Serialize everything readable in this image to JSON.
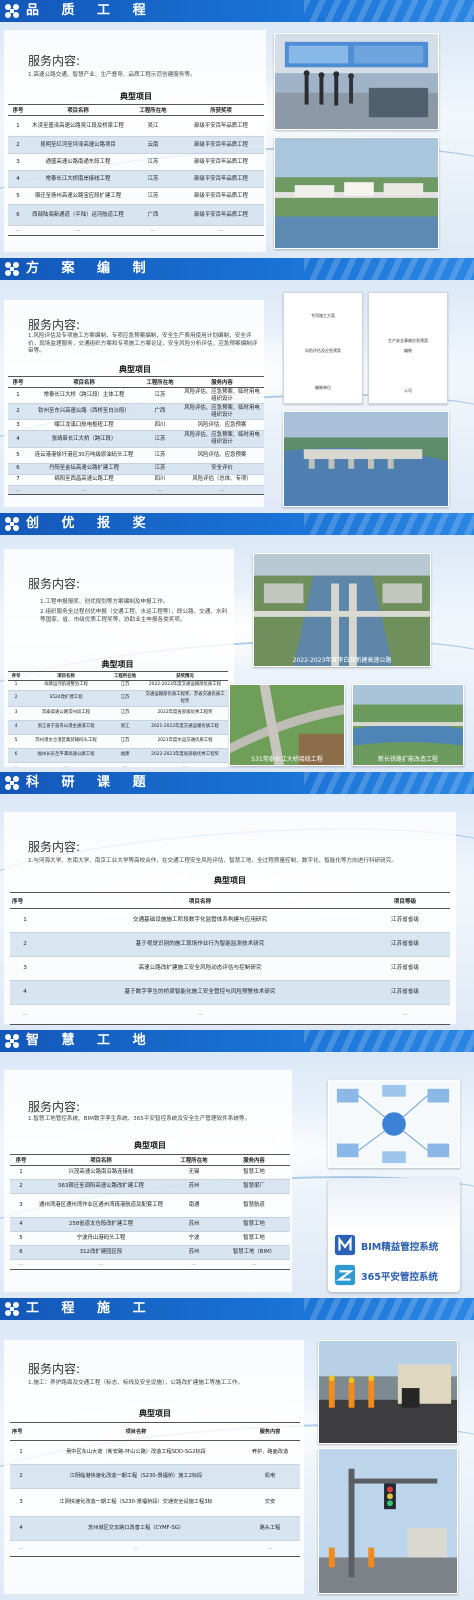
{
  "sections": {
    "s1": {
      "title": "品 质 工 程",
      "service_title": "服务内容:",
      "service_text": "1.高速公路交通、智慧产业、生产督导、品质工程示范创建服务等。",
      "table_title": "典型项目",
      "headers": [
        "序号",
        "项目名称",
        "工程所在地",
        "所获奖项"
      ],
      "rows": [
        [
          "1",
          "木渎至盛泽高速公路吴江段及桥梁工程",
          "吴江",
          "部级平安百年品质工程"
        ],
        [
          "2",
          "昆明至红河至坪泽高速公路项目",
          "云南",
          "部级平安百年品质工程"
        ],
        [
          "3",
          "通盛高速公路南通东段工程",
          "江苏",
          "部级平安百年品质工程"
        ],
        [
          "4",
          "常泰长江大桥南岸接线工程",
          "江苏",
          "部级平安百年品质工程"
        ],
        [
          "5",
          "宿迁至扬州高速公路宝应段扩建工程",
          "江苏",
          "部级平安百年品质工程"
        ],
        [
          "6",
          "西部陆海新通道（平陆）运河航道工程",
          "广西",
          "部级平安百年品质工程"
        ],
        [
          "…",
          "…",
          "…",
          "…"
        ]
      ]
    },
    "s2": {
      "title": "方 案 编 制",
      "service_title": "服务内容:",
      "service_text": "1.风险评估及专项施工方案编制，专项应急预案编制，安全生产费用使用计划编制，安全评价，现场监理服务，交通组织方案和专项施工方案论证，安全风险分析评估，应急预案编制评审等。",
      "table_title": "典型项目",
      "headers": [
        "序号",
        "项目名称",
        "工程所在地",
        "服务内容"
      ],
      "rows": [
        [
          "1",
          "常泰长江大桥（跨江段）主体工程",
          "江苏",
          "风险评估、应急预案、临时用电组织设计"
        ],
        [
          "2",
          "钦州至东兴高速公路（西桥至白沙段）",
          "广西",
          "风险评估、应急预案、临时用电组织设计"
        ],
        [
          "3",
          "岷江龙溪口航电枢纽工程",
          "四川",
          "风险评估、应急预案"
        ],
        [
          "4",
          "张靖皋长江大桥（跨江段）",
          "江苏",
          "风险评估、应急预案、临时用电组织设计"
        ],
        [
          "5",
          "连云港港徐圩港区30万吨级原油码头工程",
          "江苏",
          "风险评估、应急预案"
        ],
        [
          "6",
          "丹阳至金坛高速公路扩建工程",
          "江苏",
          "安全评价"
        ],
        [
          "7",
          "绵阳至西昌高速公路工程",
          "四川",
          "风险评估（总体、专项）"
        ],
        [
          "…",
          "…",
          "…",
          "…"
        ]
      ],
      "doc1_lines": [
        "专项施工方案",
        "风险评估及应急预案",
        "编制单位"
      ],
      "doc2_lines": [
        "生产安全事故应急预案",
        "编制",
        "公司"
      ]
    },
    "s3": {
      "title": "创 优 报 奖",
      "service_title": "服务内容:",
      "service_text_1": "1.工程申报报奖、创优规划等方案编制及申报工作。",
      "service_text_2": "2.组织服务全过程创优申报（交通工程、水运工程等），即公路、交通、水利等国家、省、市级优质工程奖等，协助业主申报各类奖项。",
      "table_title": "典型项目",
      "headers": [
        "序号",
        "项目名称",
        "工程所在地",
        "获奖情况"
      ],
      "rows": [
        [
          "1",
          "海赣运河航道整治工程",
          "江苏",
          "2022-2023年度交通运输部优质工程"
        ],
        [
          "2",
          "S524改扩建工程",
          "江苏",
          "交通运输部优质工程奖、苏省交通优质工程奖"
        ],
        [
          "3",
          "常泰高速公路常州段工程",
          "江苏",
          "2022年度省部级优秀工程奖"
        ],
        [
          "4",
          "浙江省宁波舟山港主通道工程",
          "浙江",
          "2021-2022年度交通运输优质工程"
        ],
        [
          "5",
          "苏州港太仓港区集装箱码头工程",
          "江苏",
          "2021年度水运交通优质工程"
        ],
        [
          "6",
          "福州长乐至平潭高速公路工程",
          "福建",
          "2022-2023年度省部级优秀工程奖"
        ],
        [
          "…",
          "…",
          "…",
          "…"
        ]
      ],
      "caption_main": "2022-2023年度李白获新建高速公路",
      "caption_left": "S31常泰长江大桥接线工程",
      "caption_right": "新长铁路扩能改造工程"
    },
    "s4": {
      "title": "科 研 课 题",
      "service_title": "服务内容:",
      "service_text": "1.与河海大学、东南大学、南京工业大学等高校合作，在交通工程安全风险评估、智慧工地、全过程质量控制、数字化、智能化等方向进行科研研究。",
      "table_title": "典型项目",
      "headers": [
        "序号",
        "项目名称",
        "项目等级"
      ],
      "rows": [
        [
          "1",
          "交通基础设施施工阶段数字化监管体系构建与应用研究",
          "江苏省省级"
        ],
        [
          "2",
          "基于视觉识别的施工现场作业行为智能监测技术研究",
          "江苏省省级"
        ],
        [
          "3",
          "高速公路改扩建施工安全风险动态评估与控制研究",
          "江苏省省级"
        ],
        [
          "4",
          "基于数字孪生的桥梁智能化施工安全管控与风险预警技术研究",
          "江苏省省级"
        ],
        [
          "…",
          "…",
          "…"
        ]
      ]
    },
    "s5": {
      "title": "智 慧 工 地",
      "service_title": "服务内容:",
      "service_text": "1.智慧工地管控系统、BIM数字孪生系统、365平安智控系统及安全生产管理软件系统等。",
      "table_title": "典型项目",
      "headers": [
        "序号",
        "项目名称",
        "工程所在地",
        "服务内容"
      ],
      "rows": [
        [
          "1",
          "兴茂高速公路南沿路连接线",
          "无锡",
          "智慧工地"
        ],
        [
          "2",
          "S63宿迁至泗阳高速公路改扩建工程",
          "苏州",
          "智慧梁厂"
        ],
        [
          "3",
          "通州湾港区通州湾作业区通州湾疏港航道及配套工程",
          "南通",
          "智慧航道"
        ],
        [
          "4",
          "258省道太仓段改扩建工程",
          "苏州",
          "智慧工地"
        ],
        [
          "5",
          "宁波舟山港码头工程",
          "宁波",
          "智慧工地"
        ],
        [
          "6",
          "312改扩建园区段",
          "苏州",
          "智慧工地（BIM）"
        ],
        [
          "…",
          "…",
          "…",
          "…"
        ]
      ],
      "brand1": "BIM精益管控系统",
      "brand2": "365平安管控系统"
    },
    "s6": {
      "title": "工 程 施 工",
      "service_title": "服务内容:",
      "service_text": "1.施工：养护路面及交通工程（标志、标线及安全设施），公路改扩建施工等施工工作。",
      "table_title": "典型项目",
      "headers": [
        "序号",
        "项目名称",
        "服务内容"
      ],
      "rows": [
        [
          "1",
          "吴中区东山大道（新安路-环山公路）改造工程SDD-SG2标段",
          "养护、路面改造"
        ],
        [
          "2",
          "江阴临港快速化改造一期工程（S230-景福桥）施工2标段",
          "机电"
        ],
        [
          "3",
          "江阴快速化改造一期工程（S230-景福桥段）交通安全设施工程3标",
          "交安"
        ],
        [
          "4",
          "苏州城区交叉路口改善工程（CYMF-SG）",
          "路头工程"
        ],
        [
          "…",
          "…",
          "…"
        ]
      ]
    }
  },
  "colors": {
    "title_bar": "#1a73d6",
    "table_alt_row": "#cddcec",
    "brand_text": "#2a5fb0"
  }
}
